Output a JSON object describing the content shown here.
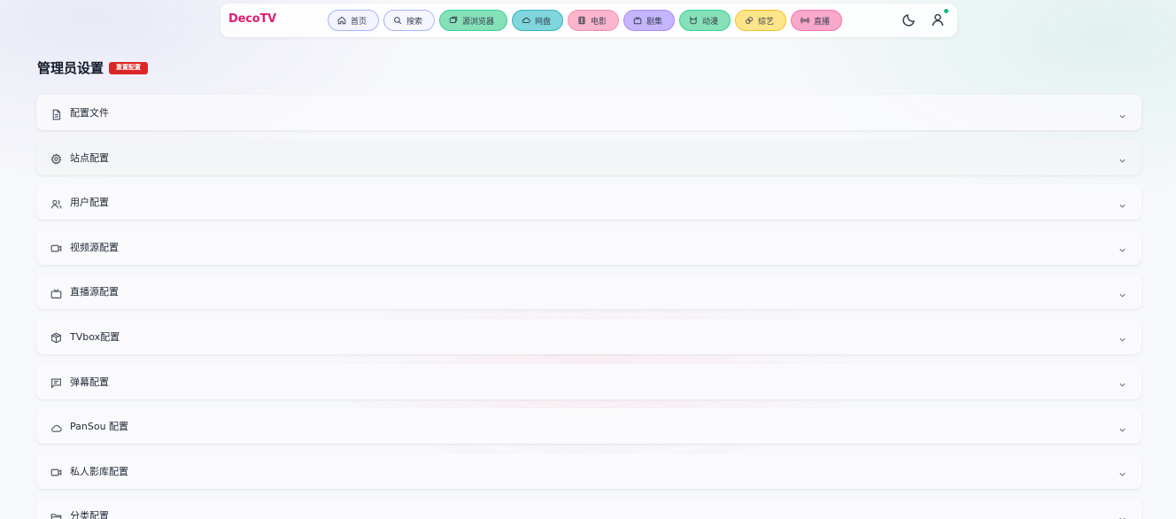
{
  "app": {
    "logo": "DecoTV"
  },
  "nav": {
    "tabs": [
      {
        "label": "首页",
        "icon": "home-icon"
      },
      {
        "label": "搜索",
        "icon": "search-icon"
      },
      {
        "label": "源浏览器",
        "icon": "browser-icon"
      },
      {
        "label": "网盘",
        "icon": "cloud-icon"
      },
      {
        "label": "电影",
        "icon": "film-icon"
      },
      {
        "label": "剧集",
        "icon": "tv-icon"
      },
      {
        "label": "动漫",
        "icon": "cat-icon"
      },
      {
        "label": "综艺",
        "icon": "party-icon"
      },
      {
        "label": "直播",
        "icon": "radio-icon"
      }
    ],
    "right_icons": [
      "moon-icon",
      "user-icon"
    ]
  },
  "page": {
    "title": "管理员设置",
    "reset_label": "重置配置"
  },
  "sections": [
    {
      "label": "配置文件",
      "icon": "file-icon"
    },
    {
      "label": "站点配置",
      "icon": "gear-icon"
    },
    {
      "label": "用户配置",
      "icon": "users-icon"
    },
    {
      "label": "视频源配置",
      "icon": "video-icon"
    },
    {
      "label": "直播源配置",
      "icon": "tv-icon"
    },
    {
      "label": "TVbox配置",
      "icon": "box-icon"
    },
    {
      "label": "弹幕配置",
      "icon": "message-icon"
    },
    {
      "label": "PanSou 配置",
      "icon": "cloud-icon"
    },
    {
      "label": "私人影库配置",
      "icon": "video-icon"
    },
    {
      "label": "分类配置",
      "icon": "folder-icon"
    }
  ],
  "colors": {
    "logo": "#e11d74",
    "reset_button": "#dc2626",
    "online_dot": "#10b981"
  }
}
